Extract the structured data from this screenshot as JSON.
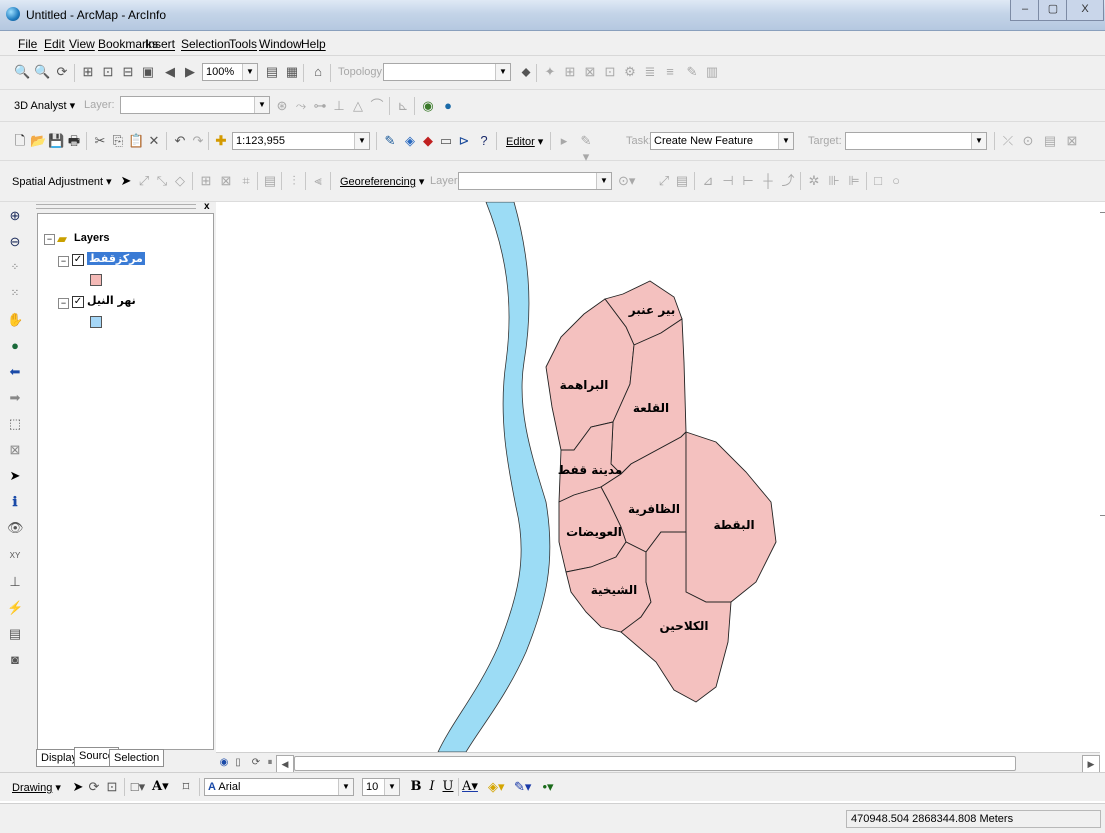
{
  "window": {
    "title": "Untitled - ArcMap - ArcInfo",
    "controls": [
      "–",
      "▢",
      "X"
    ]
  },
  "menu": [
    "File",
    "Edit",
    "View",
    "Bookmarks",
    "Insert",
    "Selection",
    "Tools",
    "Window",
    "Help"
  ],
  "toolbar1": {
    "zoom": "100%",
    "topology_label": "Topology:",
    "topology_value": ""
  },
  "toolbar2": {
    "analyst": "3D Analyst",
    "layer_label": "Layer:",
    "layer_value": ""
  },
  "toolbar3": {
    "scale": "1:123,955",
    "editor": "Editor",
    "task_label": "Task:",
    "task_value": "Create New Feature",
    "target_label": "Target:",
    "target_value": ""
  },
  "toolbar4": {
    "spatial": "Spatial Adjustment",
    "georef": "Georeferencing",
    "layer_label": "Layer:",
    "layer_value": ""
  },
  "toc": {
    "root": "Layers",
    "layers": [
      {
        "name": "مركزقفط",
        "swatch": "#f4b9b6",
        "selected": true
      },
      {
        "name": "نهر النيل",
        "swatch": "#a6d7f7",
        "selected": false
      }
    ],
    "tabs": [
      "Display",
      "Source",
      "Selection"
    ],
    "close": "x"
  },
  "map": {
    "fill_polygon": "#f4c1bf",
    "fill_river": "#9cdcf5",
    "labels": [
      "بير عنبر",
      "البراهمة",
      "القلعة",
      "مدينة قفط",
      "الظافرية",
      "العويضات",
      "البقطة",
      "الشيخية",
      "الكلاحين"
    ]
  },
  "drawing": {
    "label": "Drawing",
    "font": "Arial",
    "size": "10",
    "font_glyph": "A"
  },
  "status": {
    "coords": "470948.504  2868344.808 Meters"
  }
}
